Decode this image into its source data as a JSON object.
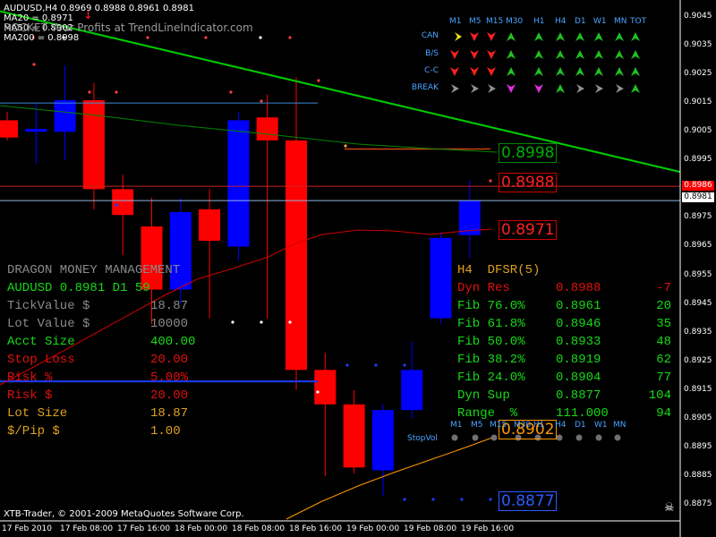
{
  "header": {
    "symbol_line": "AUDUSD,H4  0.8969 0.8988 0.8961 0.8981",
    "ma20": "MA20 = 0.8971",
    "ma50": "MA50 = 0.8902",
    "ma200": "MA200 = 0.8998"
  },
  "watermark": "ROCKET Your Profits at TrendLineIndicator.com",
  "copyright": "XTB-Trader, © 2001-2009 MetaQuotes Software Corp.",
  "price_axis": {
    "ticks": [
      "0.9045",
      "0.9035",
      "0.9025",
      "0.9015",
      "0.9005",
      "0.8995",
      "0.8985",
      "0.8975",
      "0.8965",
      "0.8955",
      "0.8945",
      "0.8935",
      "0.8925",
      "0.8915",
      "0.8905",
      "0.8895",
      "0.8885",
      "0.8875"
    ],
    "range": [
      0.887,
      0.9048
    ],
    "bid_flag": "0.8981",
    "red_flag": "0.8986"
  },
  "time_axis": [
    "17 Feb 2010",
    "17 Feb 08:00",
    "17 Feb 16:00",
    "18 Feb 00:00",
    "18 Feb 08:00",
    "18 Feb 16:00",
    "19 Feb 00:00",
    "19 Feb 08:00",
    "19 Feb 16:00"
  ],
  "candles": [
    {
      "o": 0.9009,
      "h": 0.9012,
      "l": 0.9002,
      "c": 0.9003,
      "bull": false
    },
    {
      "o": 0.9005,
      "h": 0.9015,
      "l": 0.8994,
      "c": 0.9006,
      "bull": true
    },
    {
      "o": 0.9005,
      "h": 0.9028,
      "l": 0.8995,
      "c": 0.9016,
      "bull": true
    },
    {
      "o": 0.9016,
      "h": 0.9022,
      "l": 0.8978,
      "c": 0.8985,
      "bull": false
    },
    {
      "o": 0.8985,
      "h": 0.899,
      "l": 0.8962,
      "c": 0.8976,
      "bull": false
    },
    {
      "o": 0.8972,
      "h": 0.8982,
      "l": 0.8938,
      "c": 0.895,
      "bull": false
    },
    {
      "o": 0.895,
      "h": 0.8982,
      "l": 0.8945,
      "c": 0.8977,
      "bull": true
    },
    {
      "o": 0.8978,
      "h": 0.8985,
      "l": 0.894,
      "c": 0.8967,
      "bull": false
    },
    {
      "o": 0.8965,
      "h": 0.9012,
      "l": 0.896,
      "c": 0.9009,
      "bull": true
    },
    {
      "o": 0.901,
      "h": 0.9018,
      "l": 0.894,
      "c": 0.9002,
      "bull": false
    },
    {
      "o": 0.9002,
      "h": 0.9024,
      "l": 0.8915,
      "c": 0.8922,
      "bull": false
    },
    {
      "o": 0.8922,
      "h": 0.8928,
      "l": 0.8885,
      "c": 0.891,
      "bull": false
    },
    {
      "o": 0.891,
      "h": 0.8915,
      "l": 0.8886,
      "c": 0.8888,
      "bull": false
    },
    {
      "o": 0.8887,
      "h": 0.891,
      "l": 0.8878,
      "c": 0.8908,
      "bull": true
    },
    {
      "o": 0.8908,
      "h": 0.8932,
      "l": 0.8905,
      "c": 0.8922,
      "bull": true
    },
    {
      "o": 0.894,
      "h": 0.897,
      "l": 0.8938,
      "c": 0.8968,
      "bull": true
    },
    {
      "o": 0.8969,
      "h": 0.8988,
      "l": 0.8961,
      "c": 0.8981,
      "bull": true
    }
  ],
  "levels": {
    "ma200_label": "0.8998",
    "high_label": "0.8988",
    "ma20_label": "0.8971",
    "stop_label": "0.8902",
    "sup_label": "0.8877"
  },
  "signal_table": {
    "timeframes": [
      "M1",
      "M5",
      "M15",
      "M30",
      "H1",
      "H4",
      "D1",
      "W1",
      "MN",
      "TOT"
    ],
    "rows": [
      {
        "name": "CAN",
        "arrows": [
          "yellow-right",
          "red-down",
          "red-down",
          "green-up",
          "green-up",
          "green-up",
          "green-up",
          "green-up",
          "green-up",
          "green-up"
        ]
      },
      {
        "name": "B/S",
        "arrows": [
          "red-down",
          "red-down",
          "red-down",
          "green-up",
          "green-up",
          "green-up",
          "green-up",
          "green-up",
          "green-up",
          "green-up"
        ]
      },
      {
        "name": "C-C",
        "arrows": [
          "red-down",
          "red-down",
          "red-down",
          "green-up",
          "green-up",
          "green-up",
          "green-up",
          "green-up",
          "green-up",
          "green-up"
        ]
      },
      {
        "name": "BREAK",
        "arrows": [
          "gray-right",
          "gray-right",
          "gray-right",
          "magenta-down",
          "magenta-down",
          "green-up",
          "gray-right",
          "gray-right",
          "gray-right",
          "green-up"
        ]
      }
    ]
  },
  "money_management": {
    "title": "DRAGON MONEY MANAGEMENT",
    "symbol_line": "AUDUSD 0.8981 D1 59",
    "rows": [
      {
        "label": "TickValue $",
        "value": "18.87",
        "color": "#8a8a8a"
      },
      {
        "label": "Lot Value $",
        "value": "10000",
        "color": "#8a8a8a"
      },
      {
        "label": "Acct Size",
        "value": "400.00",
        "color": "#16d916"
      },
      {
        "label": "Stop Loss",
        "value": "20.00",
        "color": "#e01010"
      },
      {
        "label": "Risk %",
        "value": "5.00%",
        "color": "#e01010"
      },
      {
        "label": "Risk $",
        "value": "20.00",
        "color": "#e01010"
      },
      {
        "label": "Lot Size",
        "value": "18.87",
        "color": "#e0a020"
      },
      {
        "label": "$/Pip $",
        "value": "1.00",
        "color": "#e0a020"
      }
    ]
  },
  "fib_panel": {
    "title": "H4  DFSR(5)",
    "rows": [
      {
        "label": "Dyn Res",
        "price": "0.8988",
        "pips": "-7",
        "color": "#e01010"
      },
      {
        "label": "Fib 76.0%",
        "price": "0.8961",
        "pips": "20",
        "color": "#16d916"
      },
      {
        "label": "Fib 61.8%",
        "price": "0.8946",
        "pips": "35",
        "color": "#16d916"
      },
      {
        "label": "Fib 50.0%",
        "price": "0.8933",
        "pips": "48",
        "color": "#16d916"
      },
      {
        "label": "Fib 38.2%",
        "price": "0.8919",
        "pips": "62",
        "color": "#16d916"
      },
      {
        "label": "Fib 24.0%",
        "price": "0.8904",
        "pips": "77",
        "color": "#16d916"
      },
      {
        "label": "Dyn Sup",
        "price": "0.8877",
        "pips": "104",
        "color": "#16d916"
      },
      {
        "label": "Range  %",
        "price": "111.000",
        "pips": "94",
        "color": "#16d916"
      }
    ]
  },
  "lower_timeframes": [
    "M1",
    "M5",
    "M15",
    "M30",
    "H1",
    "H4",
    "D1",
    "W1",
    "MN"
  ],
  "stopvol_label": "StopVol",
  "colors": {
    "bull": "#0000ff",
    "bear": "#ff0000",
    "trend": "#00cc00",
    "ma20": "#cc0000",
    "ma50": "#ff9900",
    "ma200": "#008800",
    "hline_blue": "#3b8bd6",
    "hline_red": "#cc2222"
  }
}
